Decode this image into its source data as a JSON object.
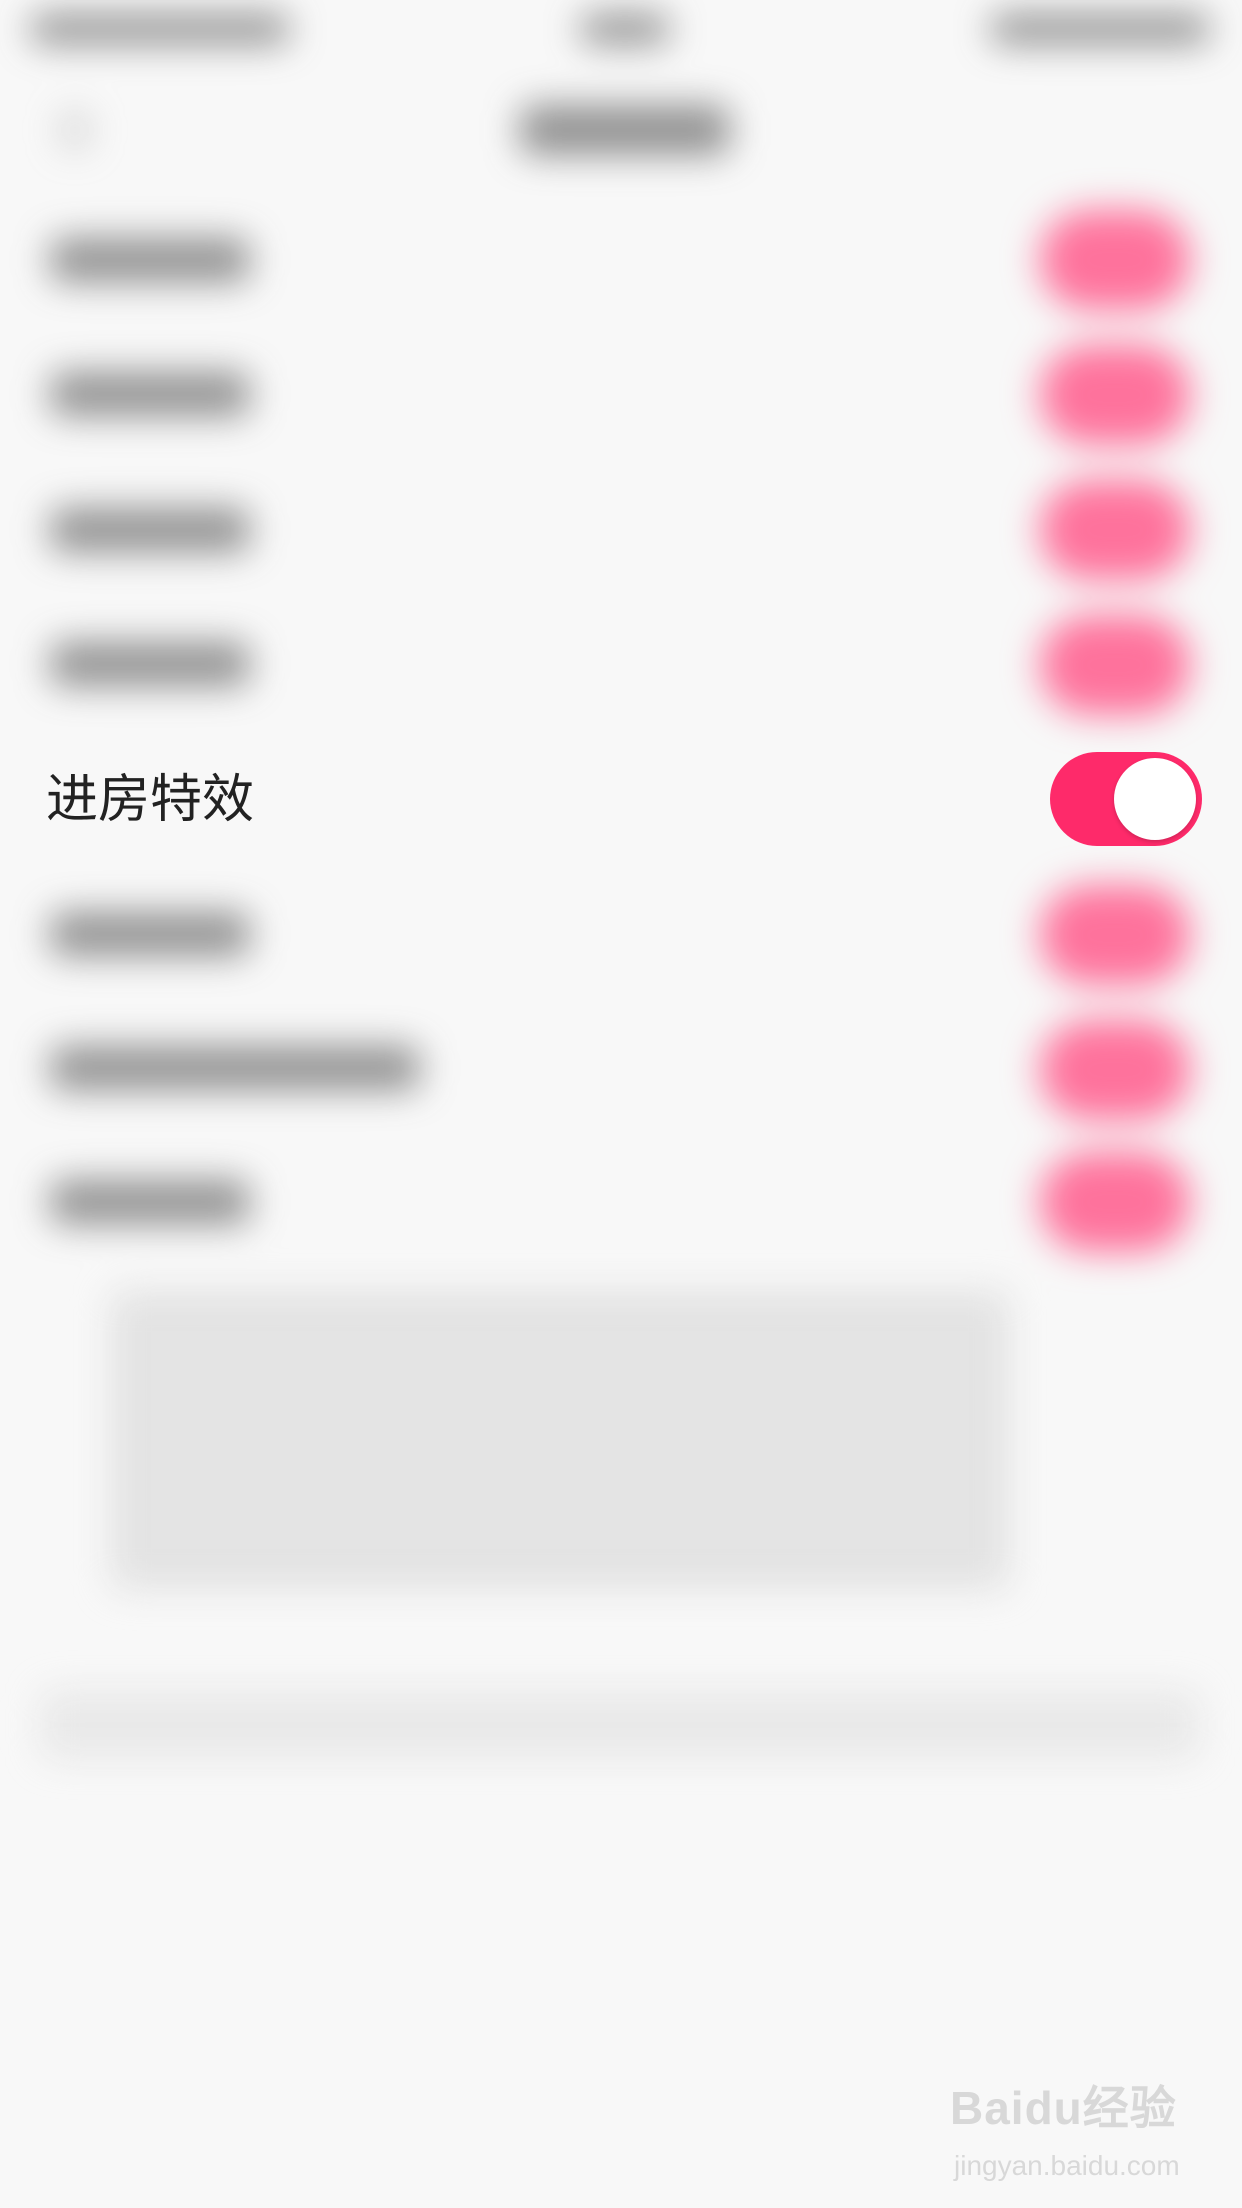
{
  "settings_row": {
    "label": "进房特效",
    "toggle_on": true,
    "toggle_color": "#fe2a6a"
  },
  "watermark": {
    "logo": "Baidu经验",
    "url": "jingyan.baidu.com"
  }
}
